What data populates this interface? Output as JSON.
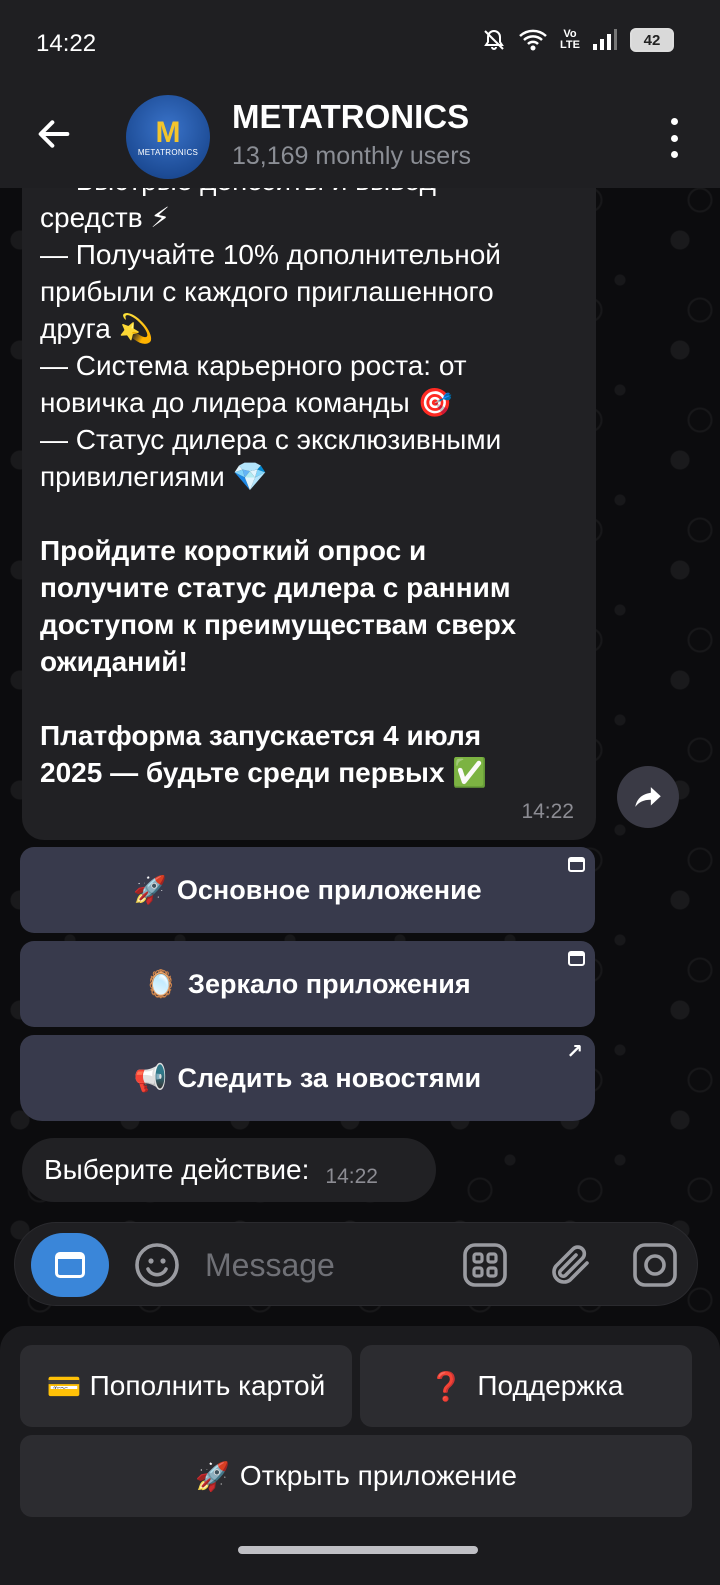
{
  "status_bar": {
    "time": "14:22",
    "network_label": "Vo LTE",
    "battery": "42",
    "icons": [
      "bell-off-icon",
      "wifi-icon",
      "volte-icon",
      "signal-icon",
      "battery-icon"
    ]
  },
  "header": {
    "title": "METATRONICS",
    "subtitle": "13,169 monthly users",
    "avatar_letter": "M",
    "avatar_text": "METATRONICS"
  },
  "message": {
    "body": "— Быстрые депозиты и вывод\nсредств ⚡\n— Получайте 10% дополнительной\nприбыли с каждого приглашенного\nдруга 💫\n— Система карьерного роста: от\nновичка до лидера команды 🎯\n— Статус дилера с эксклюзивными\nпривилегиями 💎",
    "bold_1": "Пройдите короткий опрос и\nполучите статус дилера с ранним\nдоступом к преимуществам сверх\nожиданий!",
    "bold_2": "Платформа запускается 4 июля\n2025 — будьте среди первых ✅",
    "time": "14:22"
  },
  "inline_buttons": [
    {
      "emoji": "🚀",
      "label": "Основное приложение",
      "corner": "webapp"
    },
    {
      "emoji": "🪞",
      "label": "Зеркало приложения",
      "corner": "webapp"
    },
    {
      "emoji": "📢",
      "label": "Следить за новостями",
      "corner": "↗"
    }
  ],
  "prompt_message": {
    "text": "Выберите действие:",
    "time": "14:22"
  },
  "input": {
    "placeholder": "Message"
  },
  "reply_keyboard": [
    {
      "emoji": "💳",
      "label": "Пополнить картой"
    },
    {
      "emoji": "❓",
      "label": "Поддержка"
    },
    {
      "emoji": "🚀",
      "label": "Открыть приложение"
    }
  ],
  "colors": {
    "accent": "#3a86d9",
    "bubble": "#212124",
    "inline_button": "#383a4c",
    "header": "#1f1f22"
  }
}
